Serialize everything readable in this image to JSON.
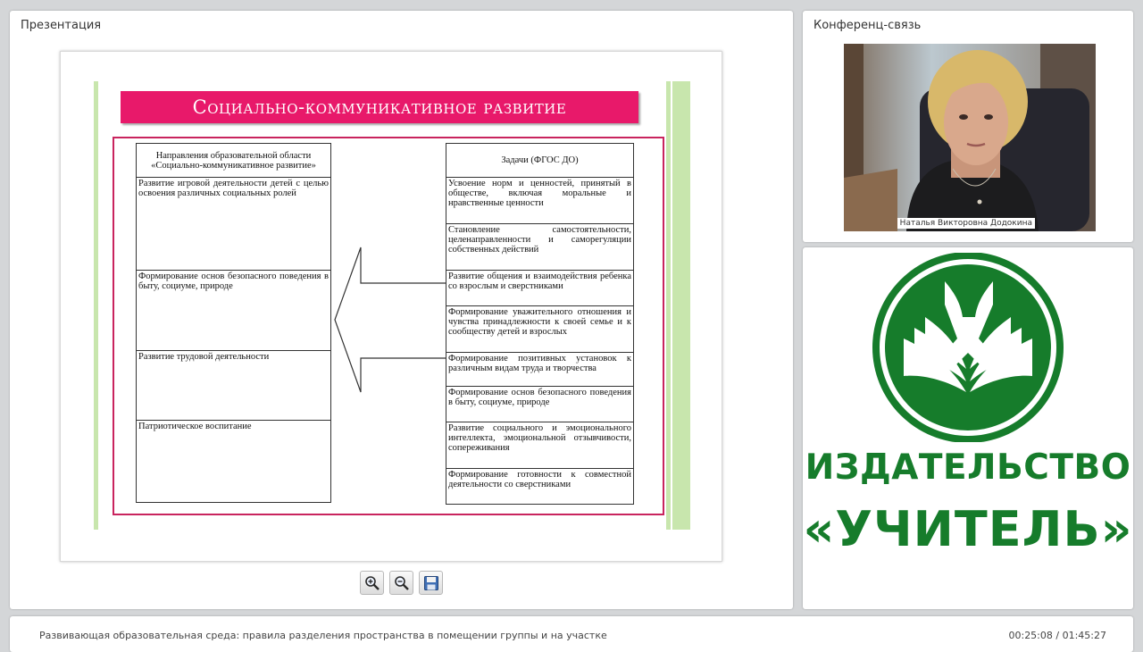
{
  "presentation": {
    "title": "Презентация",
    "slide": {
      "heading": "Социально-коммуникативное развитие",
      "left_header": "Направления образовательной области «Социально-коммуникативное развитие»",
      "left_items": [
        "Развитие игровой деятельности детей с целью освоения различных социальных ролей",
        "Формирование основ безопасного поведения в быту, социуме, природе",
        "Развитие трудовой деятельности",
        "Патриотическое воспитание"
      ],
      "right_header": "Задачи (ФГОС ДО)",
      "right_items": [
        "Усвоение норм и ценностей, принятый в обществе, включая моральные и нравственные ценности",
        "Становление самостоятельности, целенаправленности и саморегуляции собственных действий",
        "Развитие общения и взаимодействия ребенка со взрослым и сверстниками",
        "Формирование уважительного отношения и чувства принадлежности к своей семье и к сообществу детей и взрослых",
        "Формирование позитивных установок к различным видам труда и творчества",
        "Формирование основ безопасного поведения в быту, социуме, природе",
        "Развитие социального и эмоционального интеллекта, эмоциональной отзывчивости, сопереживания",
        "Формирование готовности к совместной деятельности со сверстниками"
      ]
    },
    "toolbar": {
      "zoom_in_icon": "zoom-in-icon",
      "zoom_out_icon": "zoom-out-icon",
      "save_icon": "floppy-disk-icon"
    }
  },
  "conference": {
    "title": "Конференц-связь",
    "speaker_name": "Наталья Викторовна Додокина"
  },
  "publisher": {
    "line1": "ИЗДАТЕЛЬСТВО",
    "line2": "«УЧИТЕЛЬ»",
    "color": "#167c2b"
  },
  "footer": {
    "title": "Развивающая образовательная среда: правила разделения пространства в помещении группы и на участке",
    "time": "00:25:08 / 01:45:27"
  },
  "colors": {
    "slide_title_bg": "#e8196a",
    "slide_frame": "#c9245e",
    "slide_side_bars": "#c8e6ad"
  }
}
